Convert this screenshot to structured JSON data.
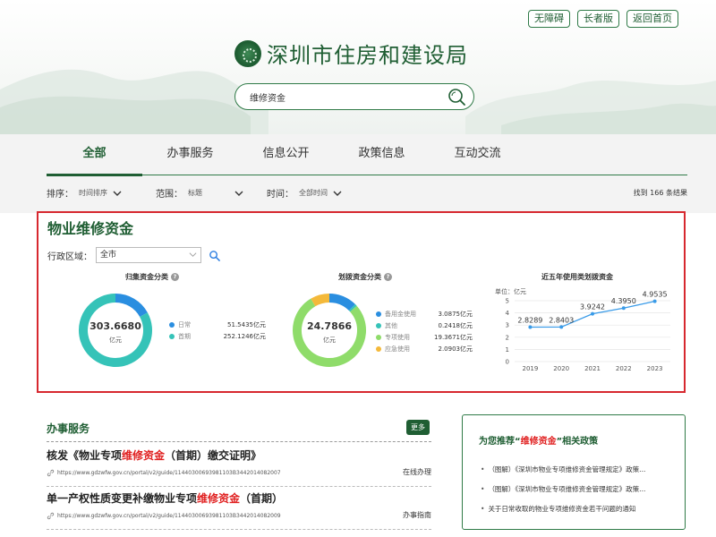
{
  "header": {
    "top_links": [
      "无障碍",
      "长者版",
      "返回首页"
    ],
    "site_title": "深圳市住房和建设局",
    "search": {
      "value": "维修资金"
    }
  },
  "tabs": [
    {
      "label": "全部",
      "active": true
    },
    {
      "label": "办事服务",
      "active": false
    },
    {
      "label": "信息公开",
      "active": false
    },
    {
      "label": "政策信息",
      "active": false
    },
    {
      "label": "互动交流",
      "active": false
    }
  ],
  "filters": {
    "sort": {
      "label": "排序：",
      "value": "时间排序"
    },
    "scope": {
      "label": "范围：",
      "value": "标题"
    },
    "time": {
      "label": "时间：",
      "value": "全部时间"
    },
    "result_count": "找到 166 条结果"
  },
  "panel": {
    "title": "物业维修资金",
    "region_label": "行政区域：",
    "region_value": "全市",
    "question_mark": "?",
    "donut1": {
      "title": "归集资金分类",
      "center_value": "303.6680",
      "center_unit": "亿元",
      "items": [
        {
          "name": "日常",
          "value": "51.5435亿元",
          "color": "#2a8ee0"
        },
        {
          "name": "首期",
          "value": "252.1246亿元",
          "color": "#35c3b8"
        }
      ]
    },
    "donut2": {
      "title": "划拨资金分类",
      "center_value": "24.7866",
      "center_unit": "亿元",
      "items": [
        {
          "name": "备用金使用",
          "value": "3.0875亿元",
          "color": "#2a8ee0"
        },
        {
          "name": "其他",
          "value": "0.2418亿元",
          "color": "#35c3b8"
        },
        {
          "name": "专项使用",
          "value": "19.3671亿元",
          "color": "#8fdc6a"
        },
        {
          "name": "应急使用",
          "value": "2.0903亿元",
          "color": "#f4b93a"
        }
      ]
    },
    "line_chart_title": "近五年使用类划拨资金"
  },
  "chart_data": [
    {
      "type": "pie",
      "title": "归集资金分类",
      "categories": [
        "日常",
        "首期"
      ],
      "values": [
        51.5435,
        252.1246
      ],
      "total": 303.668,
      "unit": "亿元"
    },
    {
      "type": "pie",
      "title": "划拨资金分类",
      "categories": [
        "备用金使用",
        "其他",
        "专项使用",
        "应急使用"
      ],
      "values": [
        3.0875,
        0.2418,
        19.3671,
        2.0903
      ],
      "total": 24.7866,
      "unit": "亿元"
    },
    {
      "type": "line",
      "title": "近五年使用类划拨资金",
      "ylabel": "单位：亿元",
      "x": [
        "2019",
        "2020",
        "2021",
        "2022",
        "2023"
      ],
      "values": [
        2.8289,
        2.8403,
        3.9242,
        4.395,
        4.9535
      ],
      "yticks": [
        "0",
        "1",
        "2",
        "3",
        "4",
        "5"
      ],
      "ylim": [
        0,
        5
      ],
      "grid": true,
      "color": "#3a9be8"
    }
  ],
  "services": {
    "title": "办事服务",
    "more": "更多",
    "items": [
      {
        "name_prefix": "核发《物业专项",
        "name_highlight": "维修资金",
        "name_suffix": "（首期）缴交证明》",
        "url": "https://www.gdzwfw.gov.cn/portal/v2/guide/11440300693981103B3442014082007",
        "type": "在线办理"
      },
      {
        "name_prefix": "单一产权性质变更补缴物业专项",
        "name_highlight": "维修资金",
        "name_suffix": "（首期）",
        "url": "https://www.gdzwfw.gov.cn/portal/v2/guide/11440300693981103B3442014082009",
        "type": "办事指南"
      }
    ]
  },
  "recommend": {
    "title_prefix": "为您推荐“",
    "title_highlight": "维修资金",
    "title_suffix": "”相关政策",
    "items": [
      "（图解）《深圳市物业专项维修资金管理规定》政策...",
      "（图解）《深圳市物业专项维修资金管理规定》政策...",
      "关于日常收取的物业专项维修资金若干问题的通知"
    ]
  }
}
